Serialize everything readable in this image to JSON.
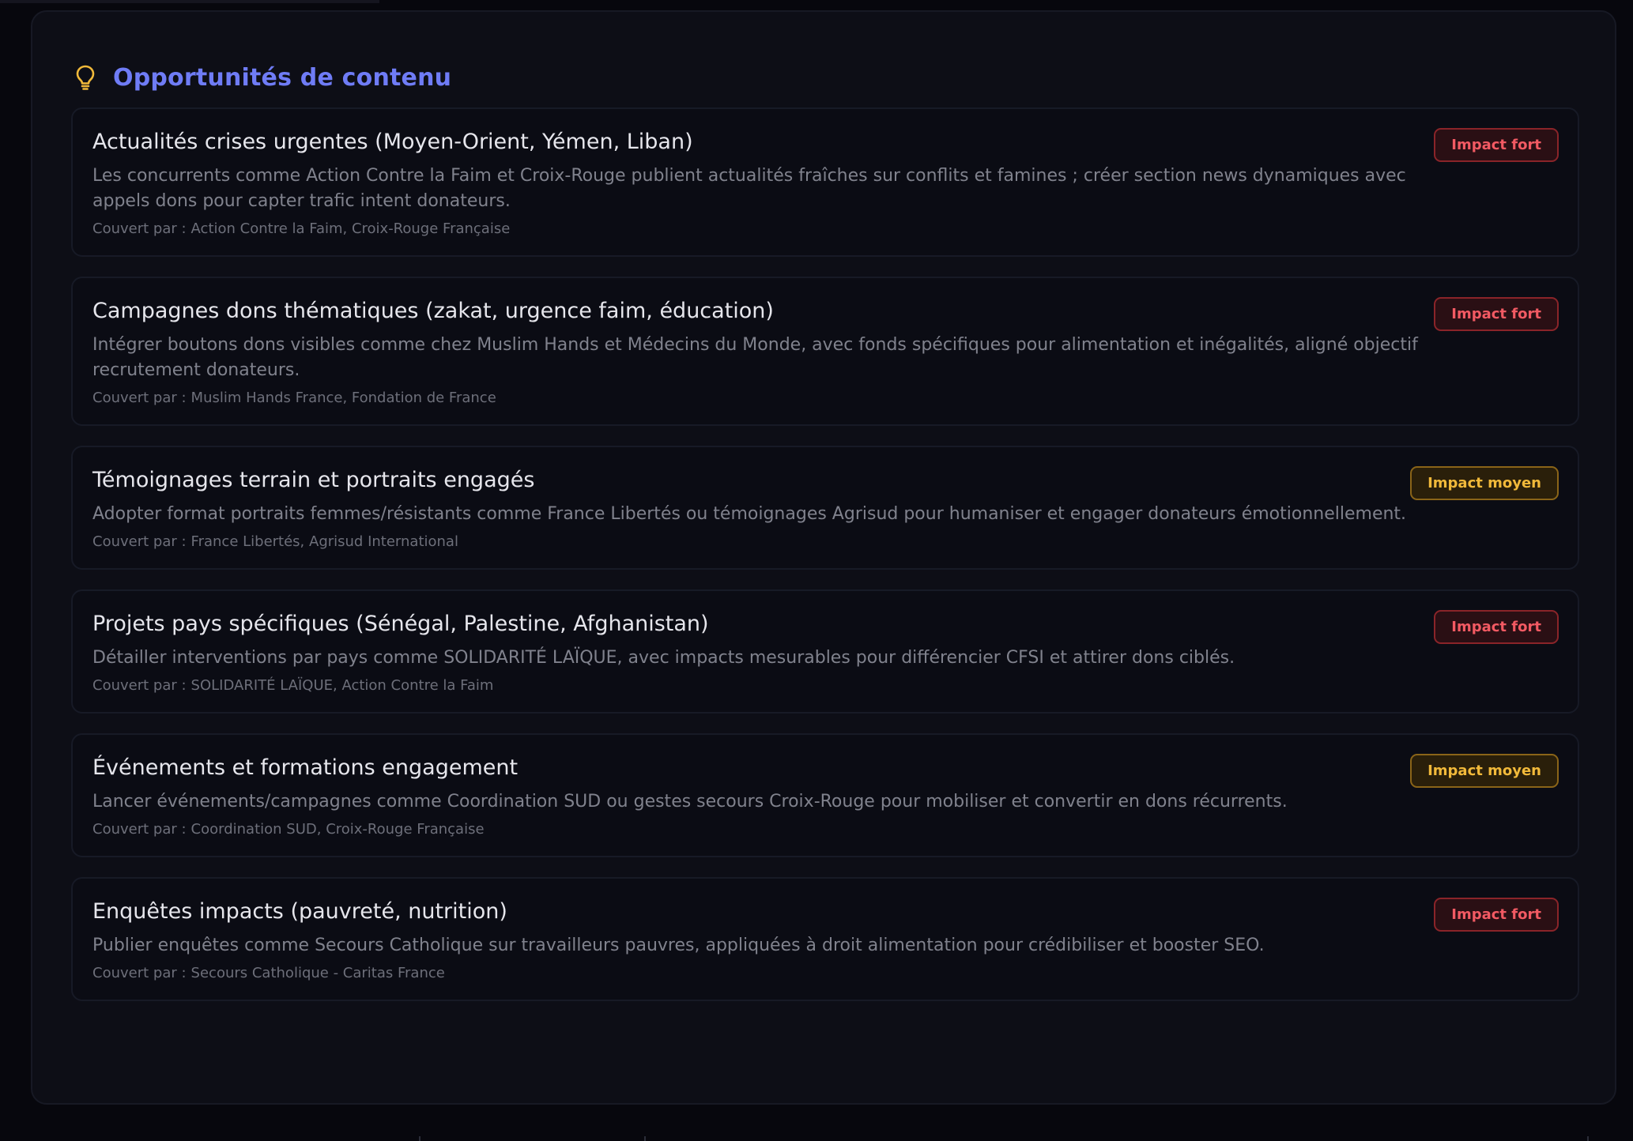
{
  "section": {
    "title": "Opportunités de contenu",
    "icon": "lightbulb-icon"
  },
  "colors": {
    "accent": "#6f7cf6",
    "bulb": "#f1b93a",
    "impact_high": "#f25a63",
    "impact_medium": "#f1b93a"
  },
  "covered_label": "Couvert par :",
  "opportunities": [
    {
      "title": "Actualités crises urgentes (Moyen-Orient, Yémen, Liban)",
      "description": "Les concurrents comme Action Contre la Faim et Croix-Rouge publient actualités fraîches sur conflits et famines ; créer section news dynamiques avec appels dons pour capter trafic intent donateurs.",
      "covered_by": "Action Contre la Faim, Croix-Rouge Française",
      "impact": "Impact fort",
      "level": "high"
    },
    {
      "title": "Campagnes dons thématiques (zakat, urgence faim, éducation)",
      "description": "Intégrer boutons dons visibles comme chez Muslim Hands et Médecins du Monde, avec fonds spécifiques pour alimentation et inégalités, aligné objectif recrutement donateurs.",
      "covered_by": "Muslim Hands France, Fondation de France",
      "impact": "Impact fort",
      "level": "high"
    },
    {
      "title": "Témoignages terrain et portraits engagés",
      "description": "Adopter format portraits femmes/résistants comme France Libertés ou témoignages Agrisud pour humaniser et engager donateurs émotionnellement.",
      "covered_by": "France Libertés, Agrisud International",
      "impact": "Impact moyen",
      "level": "medium"
    },
    {
      "title": "Projets pays spécifiques (Sénégal, Palestine, Afghanistan)",
      "description": "Détailler interventions par pays comme SOLIDARITÉ LAÏQUE, avec impacts mesurables pour différencier CFSI et attirer dons ciblés.",
      "covered_by": "SOLIDARITÉ LAÏQUE, Action Contre la Faim",
      "impact": "Impact fort",
      "level": "high"
    },
    {
      "title": "Événements et formations engagement",
      "description": "Lancer événements/campagnes comme Coordination SUD ou gestes secours Croix-Rouge pour mobiliser et convertir en dons récurrents.",
      "covered_by": "Coordination SUD, Croix-Rouge Française",
      "impact": "Impact moyen",
      "level": "medium"
    },
    {
      "title": "Enquêtes impacts (pauvreté, nutrition)",
      "description": "Publier enquêtes comme Secours Catholique sur travailleurs pauvres, appliquées à droit alimentation pour crédibiliser et booster SEO.",
      "covered_by": "Secours Catholique - Caritas France",
      "impact": "Impact fort",
      "level": "high"
    }
  ]
}
